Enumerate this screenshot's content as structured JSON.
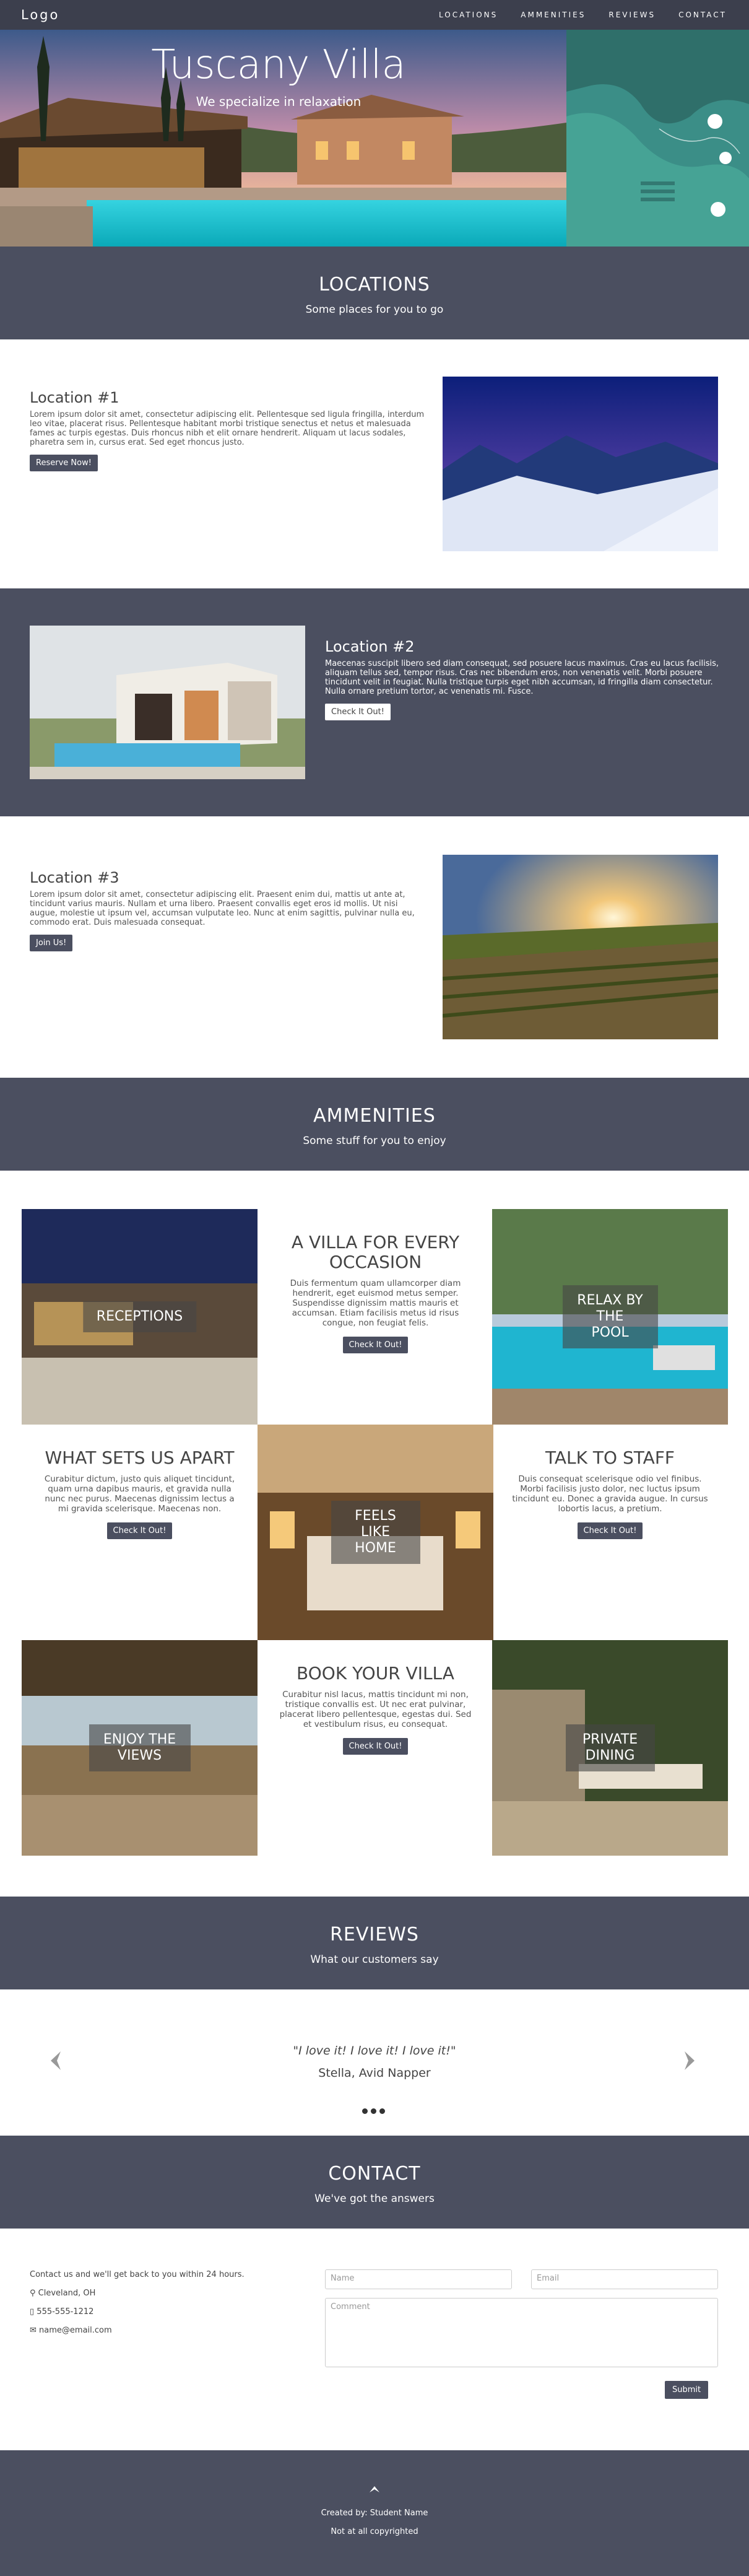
{
  "nav": {
    "logo": "Logo",
    "links": [
      "LOCATIONS",
      "AMMENITIES",
      "REVIEWS",
      "CONTACT"
    ]
  },
  "hero": {
    "title": "Tuscany Villa",
    "subtitle": "We specialize in relaxation"
  },
  "locations_header": {
    "title": "LOCATIONS",
    "subtitle": "Some places for you to go"
  },
  "locations": [
    {
      "title": "Location #1",
      "text": "Lorem ipsum dolor sit amet, consectetur adipiscing elit. Pellentesque sed ligula fringilla, interdum leo vitae, placerat risus. Pellentesque habitant morbi tristique senectus et netus et malesuada fames ac turpis egestas. Duis rhoncus nibh et elit ornare hendrerit. Aliquam ut lacus sodales, pharetra sem in, cursus erat. Sed eget rhoncus justo.",
      "button": "Reserve Now!"
    },
    {
      "title": "Location #2",
      "text": "Maecenas suscipit libero sed diam consequat, sed posuere lacus maximus. Cras eu lacus facilisis, aliquam tellus sed, tempor risus. Cras nec bibendum eros, non venenatis velit. Morbi posuere tincidunt velit in feugiat. Nulla tristique turpis eget nibh accumsan, id fringilla diam consectetur. Nulla ornare pretium tortor, ac venenatis mi. Fusce.",
      "button": "Check It Out!"
    },
    {
      "title": "Location #3",
      "text": "Lorem ipsum dolor sit amet, consectetur adipiscing elit. Praesent enim dui, mattis ut ante at, tincidunt varius mauris. Nullam et urna libero. Praesent convallis eget eros id mollis. Ut nisi augue, molestie ut ipsum vel, accumsan vulputate leo. Nunc at enim sagittis, pulvinar nulla eu, commodo erat. Duis malesuada consequat.",
      "button": "Join Us!"
    }
  ],
  "amenities_header": {
    "title": "AMMENITIES",
    "subtitle": "Some stuff for you to enjoy"
  },
  "amenities": {
    "receptions": "RECEPTIONS",
    "villa": {
      "title": "A VILLA FOR EVERY OCCASION",
      "text": "Duis fermentum quam ullamcorper diam hendrerit, eget euismod metus semper. Suspendisse dignissim mattis mauris et accumsan. Etiam facilisis metus id risus congue, non feugiat felis.",
      "button": "Check It Out!"
    },
    "pool": "RELAX BY THE POOL",
    "apart": {
      "title": "WHAT SETS US APART",
      "text": "Curabitur dictum, justo quis aliquet tincidunt, quam urna dapibus mauris, et gravida nulla nunc nec purus. Maecenas dignissim lectus a mi gravida scelerisque. Maecenas non.",
      "button": "Check It Out!"
    },
    "home": "FEELS LIKE HOME",
    "staff": {
      "title": "TALK TO STAFF",
      "text": "Duis consequat scelerisque odio vel finibus. Morbi facilisis justo dolor, nec luctus ipsum tincidunt eu. Donec a gravida augue. In cursus lobortis lacus, a pretium.",
      "button": "Check It Out!"
    },
    "views": "ENJOY THE VIEWS",
    "book": {
      "title": "BOOK YOUR VILLA",
      "text": "Curabitur nisl lacus, mattis tincidunt mi non, tristique convallis est. Ut nec erat pulvinar, placerat libero pellentesque, egestas dui. Sed et vestibulum risus, eu consequat.",
      "button": "Check It Out!"
    },
    "dining": "PRIVATE DINING"
  },
  "reviews_header": {
    "title": "REVIEWS",
    "subtitle": "What our customers say"
  },
  "review": {
    "quote": "\"I love it! I love it! I love it!\"",
    "author": "Stella, Avid Napper"
  },
  "contact_header": {
    "title": "CONTACT",
    "subtitle": "We've got the answers"
  },
  "contact": {
    "intro": "Contact us and we'll get back to you within 24 hours.",
    "location": "Cleveland, OH",
    "phone": "555-555-1212",
    "email": "name@email.com",
    "name_placeholder": "Name",
    "email_placeholder": "Email",
    "comment_placeholder": "Comment",
    "submit": "Submit"
  },
  "footer": {
    "created": "Created by: Student Name",
    "copyright": "Not at all copyrighted"
  },
  "colors": {
    "band": "#4b4f60",
    "nav": "#3c3f4d",
    "footer": "#4b4f60"
  }
}
